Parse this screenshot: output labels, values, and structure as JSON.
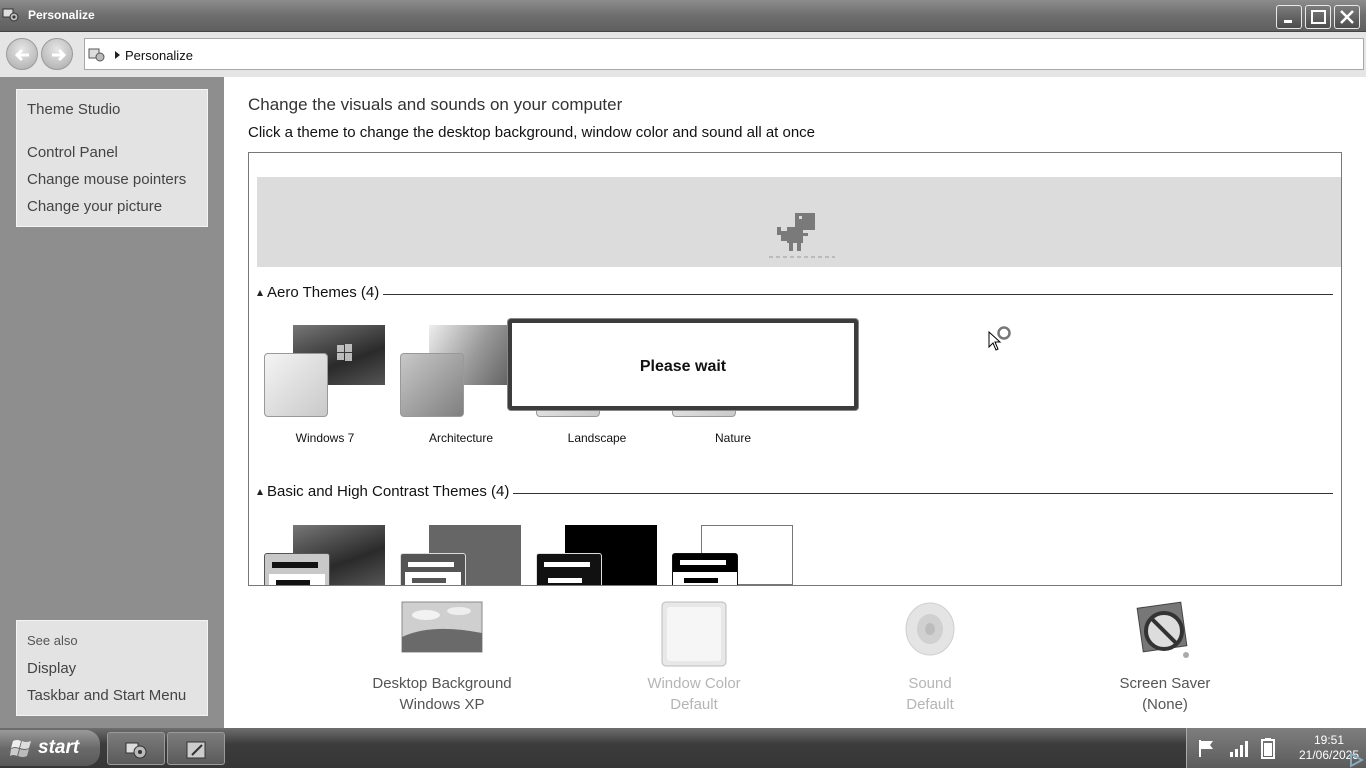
{
  "window": {
    "title": "Personalize",
    "buttons": [
      "minimize",
      "maximize",
      "close"
    ]
  },
  "address": {
    "breadcrumb": "Personalize"
  },
  "sidebar": {
    "top_links": [
      "Theme Studio",
      "Control Panel",
      "Change mouse pointers",
      "Change your picture"
    ],
    "see_also_title": "See also",
    "see_also_links": [
      "Display",
      "Taskbar and Start Menu"
    ]
  },
  "main": {
    "heading": "Change the visuals and sounds on your computer",
    "subheading": "Click a theme to change the desktop background, window color and sound all at once",
    "groups": [
      {
        "title": "Aero Themes (4)",
        "themes": [
          "Windows 7",
          "Architecture",
          "Landscape",
          "Nature"
        ]
      },
      {
        "title": "Basic and High Contrast Themes (4)",
        "themes": []
      }
    ],
    "bottom": [
      {
        "title": "Desktop Background",
        "value": "Windows XP"
      },
      {
        "title": "Window Color",
        "value": "Default"
      },
      {
        "title": "Sound",
        "value": "Default"
      },
      {
        "title": "Screen Saver",
        "value": "(None)"
      }
    ]
  },
  "dialog": {
    "message": "Please wait"
  },
  "taskbar": {
    "start_label": "start",
    "time": "19:51",
    "date": "21/06/2025"
  },
  "icons": {
    "control_panel": "control-panel-icon",
    "back": "back-arrow-icon",
    "forward": "forward-arrow-icon",
    "dino": "offline-dino-icon",
    "busy_cursor": "busy-cursor-icon"
  },
  "colors": {
    "titlebar": "#6e6e6e",
    "sidebar": "#8e8e8e",
    "taskbar": "#3c3c3c"
  }
}
